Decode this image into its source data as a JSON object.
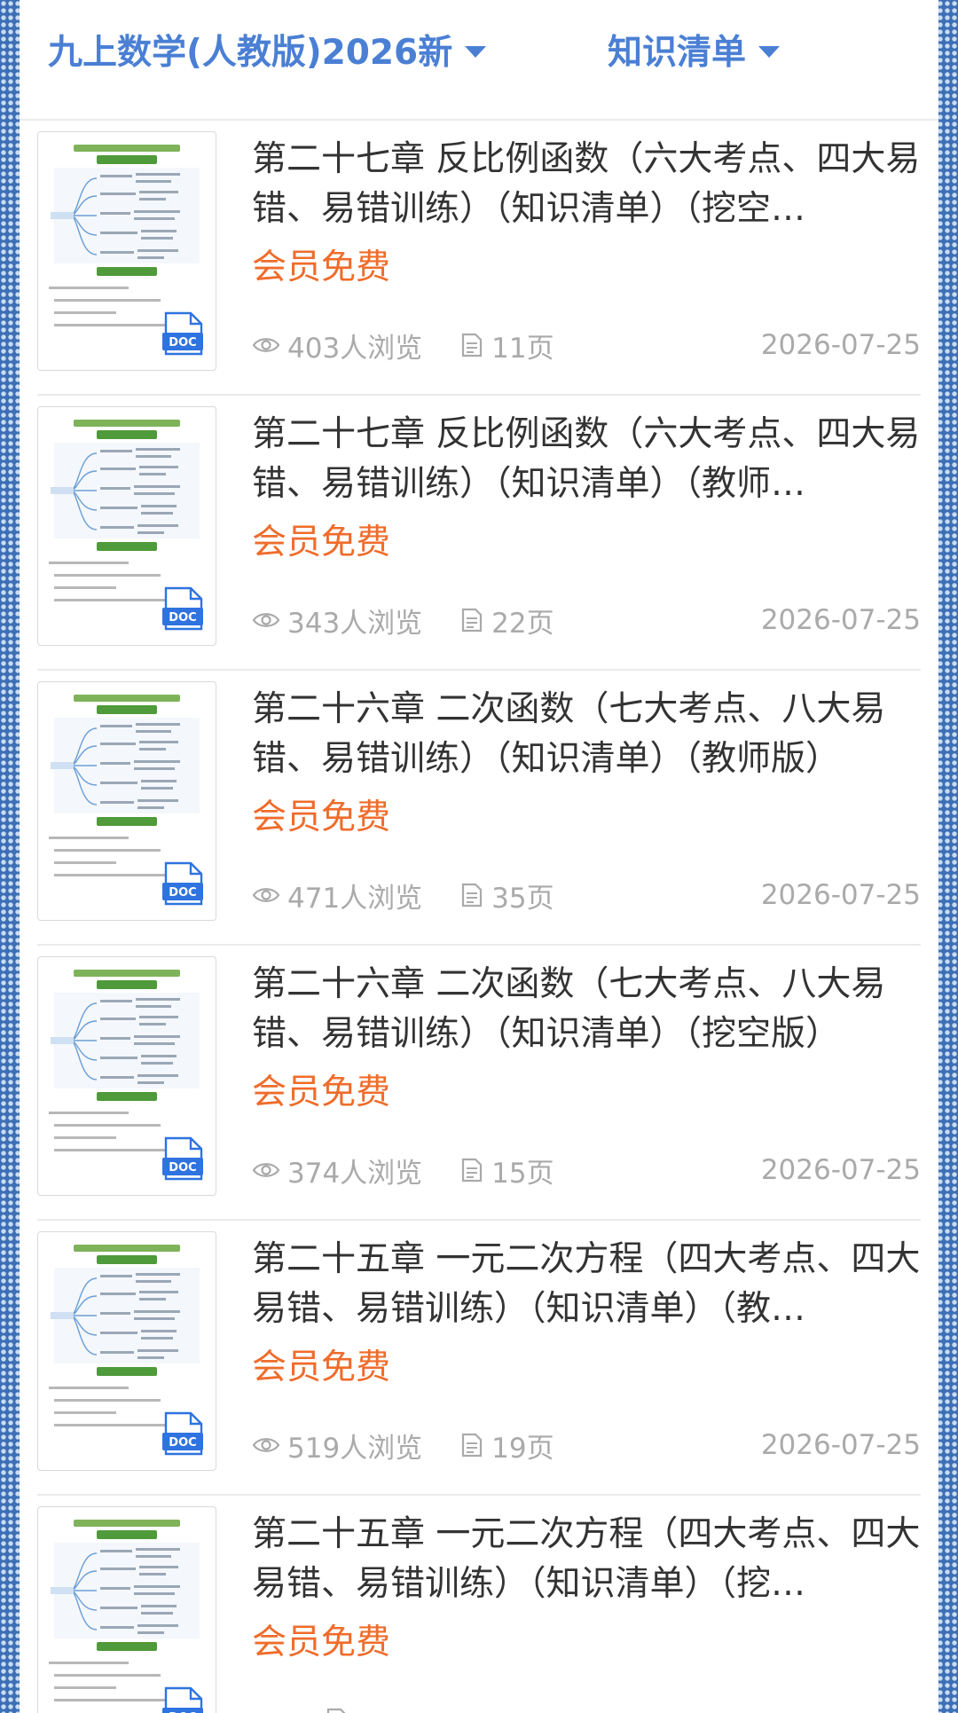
{
  "header": {
    "filter_grade": "九上数学(人教版)2026新",
    "filter_type": "知识清单"
  },
  "items": [
    {
      "title": "第二十七章 反比例函数（六大考点、四大易错、易错训练）（知识清单）（挖空…",
      "price": "会员免费",
      "views": "403人浏览",
      "pages": "11页",
      "date": "2026-07-25",
      "thumb_icon": "doc-icon"
    },
    {
      "title": "第二十七章 反比例函数（六大考点、四大易错、易错训练）（知识清单）（教师…",
      "price": "会员免费",
      "views": "343人浏览",
      "pages": "22页",
      "date": "2026-07-25",
      "thumb_icon": "doc-icon"
    },
    {
      "title": "第二十六章 二次函数（七大考点、八大易错、易错训练）（知识清单）（教师版）",
      "price": "会员免费",
      "views": "471人浏览",
      "pages": "35页",
      "date": "2026-07-25",
      "thumb_icon": "doc-icon"
    },
    {
      "title": "第二十六章 二次函数（七大考点、八大易错、易错训练）（知识清单）（挖空版）",
      "price": "会员免费",
      "views": "374人浏览",
      "pages": "15页",
      "date": "2026-07-25",
      "thumb_icon": "doc-icon"
    },
    {
      "title": "第二十五章 一元二次方程（四大考点、四大易错、易错训练）（知识清单）（教…",
      "price": "会员免费",
      "views": "519人浏览",
      "pages": "19页",
      "date": "2026-07-25",
      "thumb_icon": "doc-icon"
    },
    {
      "title": "第二十五章 一元二次方程（四大考点、四大易错、易错训练）（知识清单）（挖…",
      "price": "会员免费",
      "views": "",
      "pages": "",
      "date": "",
      "thumb_icon": "doc-icon"
    }
  ],
  "colors": {
    "accent": "#4a7fd4",
    "price": "#ef6c2b",
    "meta": "#aaaaaa",
    "background": "#3d6fb5"
  },
  "icons": {
    "filter_caret": "caret-down-icon",
    "views": "eye-icon",
    "pages": "page-icon",
    "file_type": "doc-icon"
  }
}
